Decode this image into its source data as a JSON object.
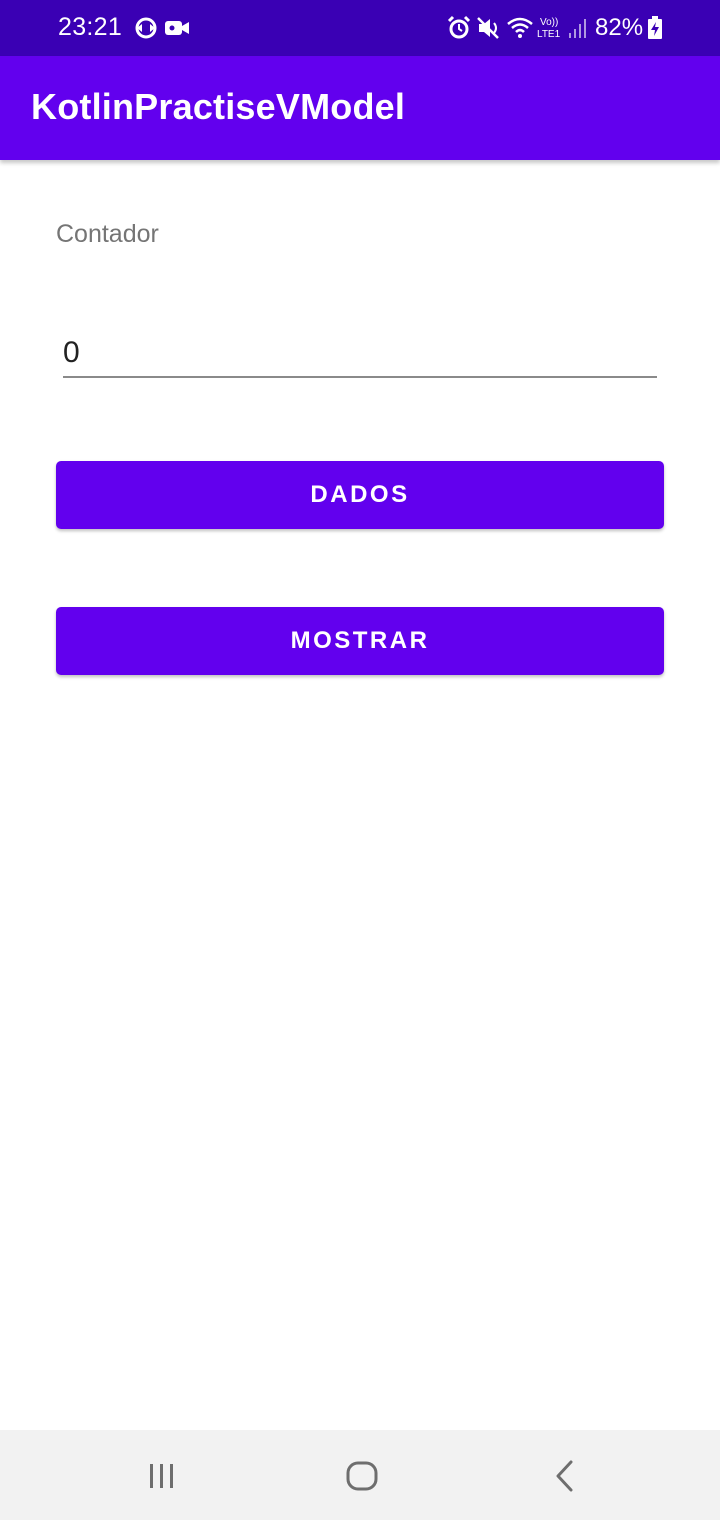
{
  "status_bar": {
    "time": "23:21",
    "battery": "82%",
    "background_color": "#3a00b4",
    "icons": [
      "sync-icon",
      "video-camera-icon",
      "alarm-icon",
      "mute-icon",
      "wifi-icon",
      "volte-lte-icon",
      "signal-icon",
      "battery-charging-icon"
    ]
  },
  "app_bar": {
    "title": "KotlinPractiseVModel",
    "background_color": "#6200ee"
  },
  "main": {
    "label": "Contador",
    "counter_value": "0",
    "dados_button": "DADOS",
    "mostrar_button": "MOSTRAR",
    "button_color": "#6200ee"
  },
  "nav_bar": {
    "icons": [
      "recent-apps-icon",
      "home-icon",
      "back-icon"
    ]
  }
}
